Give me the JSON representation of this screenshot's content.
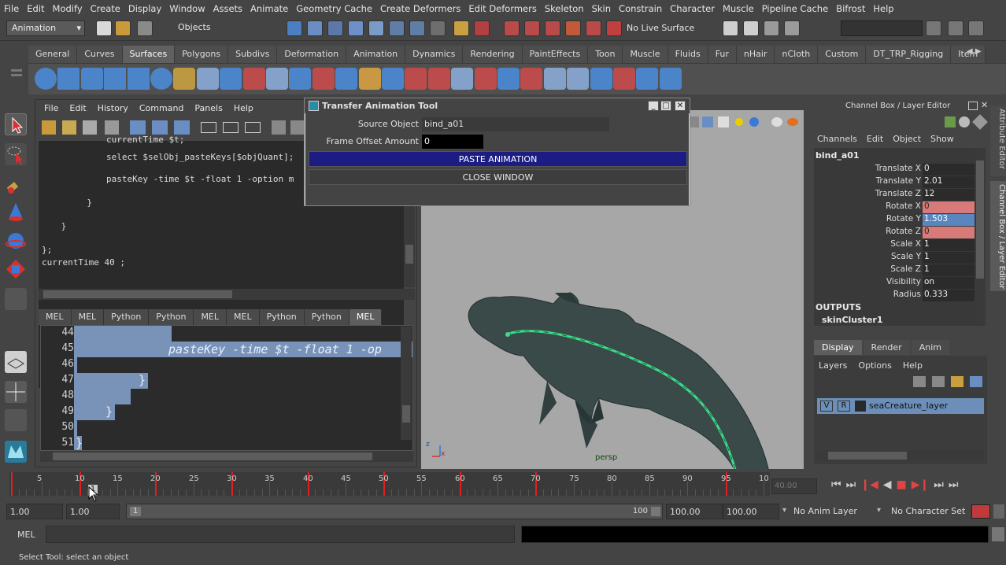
{
  "menubar": [
    "File",
    "Edit",
    "Modify",
    "Create",
    "Display",
    "Window",
    "Assets",
    "Animate",
    "Geometry Cache",
    "Create Deformers",
    "Edit Deformers",
    "Skeleton",
    "Skin",
    "Constrain",
    "Character",
    "Muscle",
    "Pipeline Cache",
    "Bifrost",
    "Help"
  ],
  "status": {
    "mode": "Animation",
    "objects_label": "Objects",
    "live_surface": "No Live Surface"
  },
  "shelf_tabs": [
    "General",
    "Curves",
    "Surfaces",
    "Polygons",
    "Subdivs",
    "Deformation",
    "Animation",
    "Dynamics",
    "Rendering",
    "PaintEffects",
    "Toon",
    "Muscle",
    "Fluids",
    "Fur",
    "nHair",
    "nCloth",
    "Custom",
    "DT_TRP_Rigging",
    "Item"
  ],
  "shelf_active": "Surfaces",
  "script_editor": {
    "menu": [
      "File",
      "Edit",
      "History",
      "Command",
      "Panels",
      "Help"
    ],
    "output_lines": [
      {
        "text": "currentTime $t;",
        "indent": 10
      },
      {
        "text": "select $selObj_pasteKeys[$objQuant];",
        "indent": 10
      },
      {
        "text": "pasteKey -time $t -float 1 -option m",
        "indent": 10
      },
      {
        "text": "}",
        "indent": 7
      },
      {
        "text": "}",
        "indent": 3
      },
      {
        "text": "};",
        "indent": 0
      },
      {
        "text": "currentTime 40 ;",
        "indent": 0
      }
    ],
    "tabs": [
      "MEL",
      "MEL",
      "Python",
      "Python",
      "MEL",
      "MEL",
      "Python",
      "Python",
      "MEL"
    ],
    "active_tab_index": 8,
    "line_numbers": [
      "44",
      "45",
      "46",
      "47",
      "48",
      "49",
      "50",
      "51"
    ],
    "editor_line_45": "pasteKey -time $t -float 1 -op",
    "editor_line_47": "}",
    "editor_line_49": "}",
    "editor_line_51": "}"
  },
  "viewport": {
    "camera": "persp",
    "axis_z": "z",
    "axis_x": "x"
  },
  "dialog": {
    "title": "Transfer Animation Tool",
    "source_label": "Source Object",
    "source_value": "bind_a01",
    "offset_label": "Frame Offset Amount",
    "offset_value": "0",
    "paste_button": "PASTE ANIMATION",
    "close_button": "CLOSE WINDOW",
    "colors": {
      "paste": "#1c1c82",
      "close": "#3d3d3d"
    }
  },
  "channel_box": {
    "title": "Channel Box / Layer Editor",
    "menu": [
      "Channels",
      "Edit",
      "Object",
      "Show"
    ],
    "object": "bind_a01",
    "attributes": [
      {
        "name": "Translate X",
        "value": "0",
        "state": "normal"
      },
      {
        "name": "Translate Y",
        "value": "2.01",
        "state": "normal"
      },
      {
        "name": "Translate Z",
        "value": "12",
        "state": "normal"
      },
      {
        "name": "Rotate X",
        "value": "0",
        "state": "keyed"
      },
      {
        "name": "Rotate Y",
        "value": "1.503",
        "state": "selected"
      },
      {
        "name": "Rotate Z",
        "value": "0",
        "state": "keyed"
      },
      {
        "name": "Scale X",
        "value": "1",
        "state": "normal"
      },
      {
        "name": "Scale Y",
        "value": "1",
        "state": "normal"
      },
      {
        "name": "Scale Z",
        "value": "1",
        "state": "normal"
      },
      {
        "name": "Visibility",
        "value": "on",
        "state": "normal"
      },
      {
        "name": "Radius",
        "value": "0.333",
        "state": "normal"
      }
    ],
    "outputs_label": "OUTPUTS",
    "outputs": [
      "skinCluster1"
    ],
    "side_tabs": [
      "Attribute Editor",
      "Channel Box / Layer Editor"
    ]
  },
  "layer_editor": {
    "tabs": [
      "Display",
      "Render",
      "Anim"
    ],
    "active_tab": "Display",
    "menu": [
      "Layers",
      "Options",
      "Help"
    ],
    "layer": {
      "v": "V",
      "r": "R",
      "name": "seaCreature_layer"
    }
  },
  "timeline": {
    "ticks": [
      "5",
      "10",
      "15",
      "20",
      "25",
      "30",
      "35",
      "40",
      "45",
      "50",
      "55",
      "60",
      "65",
      "70",
      "75",
      "80",
      "85",
      "90",
      "95",
      "10"
    ],
    "keyframes": [
      1,
      10,
      20,
      30,
      40,
      50,
      60,
      70,
      95
    ],
    "current_frame": "1",
    "end_field": "40.00"
  },
  "range": {
    "start": "1.00",
    "anim_start": "1.00",
    "slider_start": "1",
    "slider_end": "100",
    "anim_end": "100.00",
    "end": "100.00",
    "anim_layer": "No Anim Layer",
    "character_set": "No Character Set"
  },
  "cmdline": {
    "label": "MEL"
  },
  "help_line": "Select Tool: select an object"
}
